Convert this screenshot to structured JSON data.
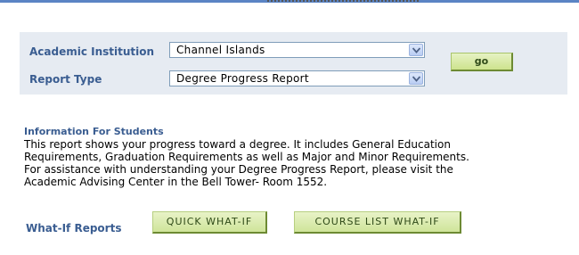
{
  "form": {
    "institution_label": "Academic Institution",
    "institution_value": "Channel Islands",
    "report_type_label": "Report Type",
    "report_type_value": "Degree Progress Report",
    "go_label": "go"
  },
  "info": {
    "title": "Information For Students",
    "lines": [
      "This report shows your progress toward a degree. It includes General Education",
      "Requirements, Graduation Requirements as well as Major and Minor Requirements.",
      "For assistance with understanding your Degree Progress Report, please visit the",
      "Academic Advising Center in the Bell Tower- Room 1552."
    ]
  },
  "whatif": {
    "label": "What-If Reports",
    "quick_label": "QUICK WHAT-IF",
    "course_list_label": "COURSE LIST WHAT-IF"
  },
  "icons": {
    "dropdown": "chevron-down-icon"
  },
  "colors": {
    "label_blue": "#3a5d91",
    "panel_bg": "#e6ebf2",
    "button_green": "#cfe49a"
  }
}
